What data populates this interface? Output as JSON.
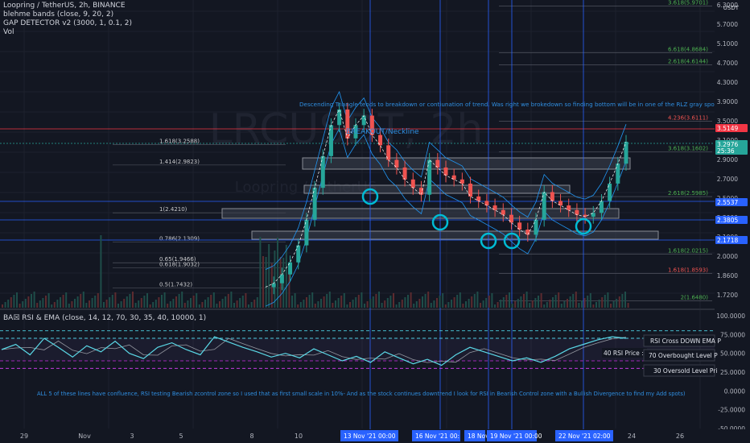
{
  "header": {
    "title": "Loopring / TetherUS, 2h, BINANCE",
    "indicators": [
      "blehme bands (close, 9, 20, 2)",
      "GAP DETECTOR v2 (3000, 1, 0.1, 2)",
      "Vol"
    ]
  },
  "watermark": {
    "symbol": "LRCUSDT, 2h",
    "sub": "Loopring / TetherUS"
  },
  "currency_badge": "USDT",
  "annotations": {
    "top_note": "Descending Triangle tends to breakdown or contiunation of trend. Was right we brokedown so finding bottom will be in one of the RLZ gray spots",
    "breakout": "BREAKOUT/Neckline",
    "bottom_note": "ALL 5 of these lines have confluence, RSI testing Bearish zcontrol zone so I used that as first small scale in 10%- And as the stock continues downtrend I look for RSI in Bearish Control zone with a Bullish Divergence to find my Add spots)"
  },
  "rsi_panel": {
    "title": "BA☒ RSI & EMA (close, 14, 12, 70, 30, 35, 40, 10000, 1)",
    "tooltips": [
      "RSI Cross DOWN EMA P",
      "40 RSI Price : 2.",
      "70 Overbought Level P",
      "30 Oversold Level Pri"
    ]
  },
  "price_badges": [
    {
      "label": "3.5149",
      "color": "#f23645"
    },
    {
      "label": "3.2976\n25:36",
      "color": "#26a69a"
    },
    {
      "label": "2.5537",
      "color": "#2962ff"
    },
    {
      "label": "2.3805",
      "color": "#2962ff"
    },
    {
      "label": "2.1718",
      "color": "#2962ff"
    }
  ],
  "time_badges": [
    "13 Nov '21  00:00",
    "16 Nov '21  00:",
    "18 Nov",
    "19 Nov '21  00:00",
    "22 Nov '21  02:00"
  ],
  "colors": {
    "up": "#26a69a",
    "down": "#ef5350",
    "vline": "#2962ff",
    "circle": "#00bcd4",
    "rsi": "#5ad8e6",
    "band": "#2196f3",
    "text_blue": "#2f8ee0"
  },
  "chart_data": [
    {
      "type": "line",
      "title": "Loopring / TetherUS, 2h, BINANCE",
      "ylim": [
        1.6,
        6.0
      ],
      "y_scale": "log",
      "y_tick_labels": [
        "6.3000",
        "5.7000",
        "5.1000",
        "4.7000",
        "4.3000",
        "3.9000",
        "3.5000",
        "3.1000",
        "2.9000",
        "2.7000",
        "2.5000",
        "2.3000",
        "2.1000",
        "2.0000",
        "1.8600",
        "1.7200"
      ],
      "x_tick_labels": [
        "29",
        "Nov",
        "3",
        "5",
        "8",
        "10",
        "24",
        "26"
      ],
      "series": [
        {
          "values": [
            1.75,
            1.78,
            1.85,
            1.95,
            2.1,
            2.35,
            2.7,
            3.1,
            3.55,
            3.8,
            3.35,
            3.55,
            3.7,
            3.4,
            3.25,
            3.05,
            2.95,
            2.8,
            2.7,
            2.62,
            3.05,
            2.95,
            2.85,
            2.8,
            2.75,
            2.6,
            2.55,
            2.5,
            2.45,
            2.4,
            2.32,
            2.25,
            2.2,
            2.35,
            2.65,
            2.55,
            2.5,
            2.45,
            2.4,
            2.38,
            2.42,
            2.55,
            2.75,
            3.0,
            3.3
          ]
        }
      ],
      "fib_levels": [
        {
          "label": "3.618(5.9701)"
        },
        {
          "label": "6.618(4.8684)"
        },
        {
          "label": "2.618(4.6144)"
        },
        {
          "label": "4.236(3.6111)"
        },
        {
          "label": "3.618(3.1602)"
        },
        {
          "label": "1.618(3.2588)"
        },
        {
          "label": "1.414(2.9823)"
        },
        {
          "label": "2.618(2.5985)"
        },
        {
          "label": "1(2.4210)"
        },
        {
          "label": "0.786(2.1309)"
        },
        {
          "label": "1.618(2.0215)"
        },
        {
          "label": "0.65(1.9466)"
        },
        {
          "label": "0.618(1.9032)"
        },
        {
          "label": "1.618(1.8593)"
        },
        {
          "label": "0.5(1.7432)"
        },
        {
          "label": "2(1.6480)"
        }
      ]
    },
    {
      "type": "line",
      "title": "BA☒ RSI & EMA (close, 14, 12, 70, 30, 35, 40, 10000, 1)",
      "ylim": [
        -50,
        100
      ],
      "y_tick_labels": [
        "100.0000",
        "75.0000",
        "50.0000",
        "25.0000",
        "0.0000",
        "-25.0000",
        "-50.0000"
      ],
      "levels": [
        80,
        70,
        40,
        30
      ],
      "series": [
        {
          "values": [
            55,
            62,
            48,
            70,
            58,
            45,
            60,
            52,
            66,
            50,
            43,
            58,
            64,
            55,
            48,
            72,
            65,
            58,
            52,
            45,
            50,
            44,
            56,
            48,
            40,
            46,
            38,
            52,
            44,
            36,
            42,
            34,
            48,
            58,
            52,
            46,
            40,
            44,
            38,
            46,
            56,
            62,
            68,
            72,
            70
          ]
        }
      ]
    }
  ]
}
